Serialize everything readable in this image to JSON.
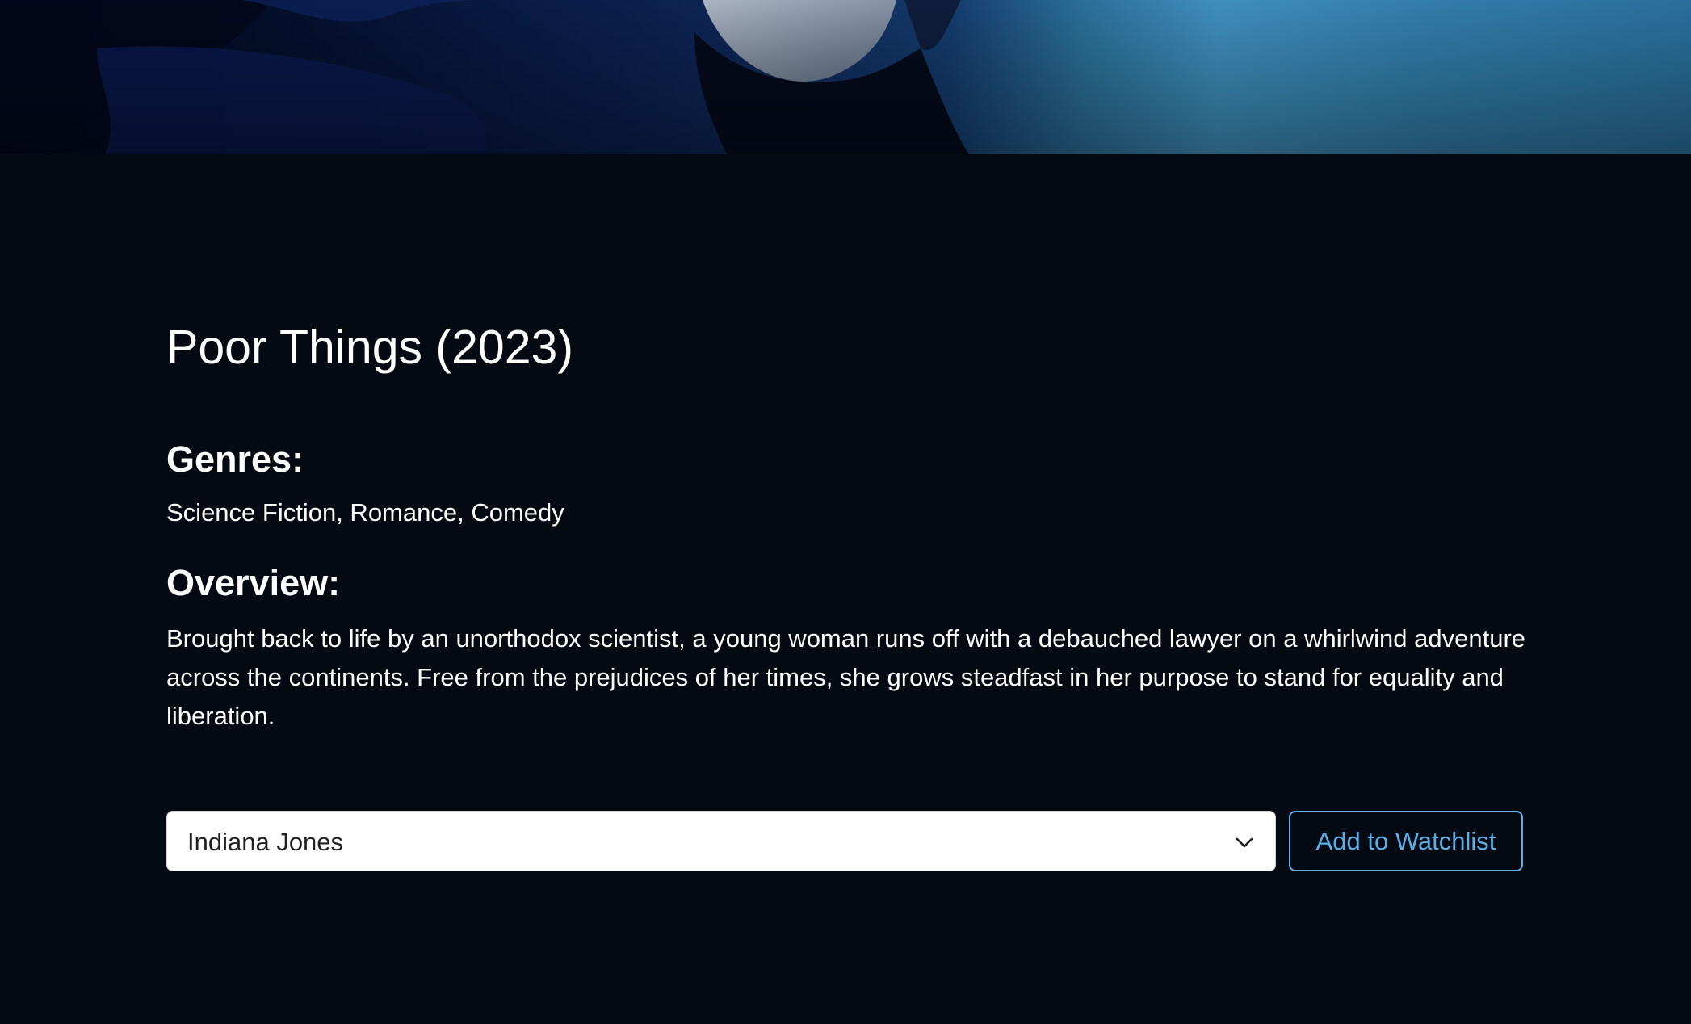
{
  "movie": {
    "title": "Poor Things (2023)",
    "genres_heading": "Genres:",
    "genres": "Science Fiction, Romance, Comedy",
    "overview_heading": "Overview:",
    "overview": "Brought back to life by an unorthodox scientist, a young woman runs off with a debauched lawyer on a whirlwind adventure across the continents. Free from the prejudices of her times, she grows steadfast in her purpose to stand for equality and liberation."
  },
  "watchlist": {
    "selected": "Indiana Jones",
    "dropdown_icon": "chevron-down-icon",
    "add_label": "Add to Watchlist",
    "accent_color": "#5ab1ea"
  },
  "theme": {
    "background": "#050a12",
    "text": "#ffffff"
  }
}
